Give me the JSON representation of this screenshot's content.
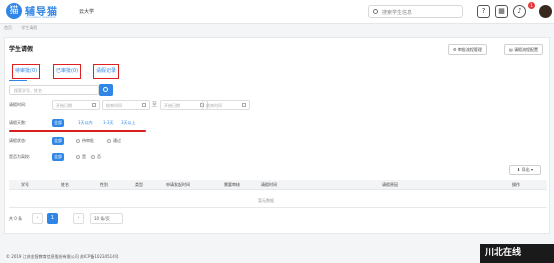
{
  "header": {
    "brand_title": "辅导猫",
    "brand_subtitle": "Counselor Assistant",
    "school": "云大学",
    "search_placeholder": "搜索学生信息",
    "help_glyph": "?",
    "notification_count": "1"
  },
  "breadcrumb": [
    "首页",
    "学生请假"
  ],
  "page": {
    "title": "学生请假",
    "buttons": [
      "审批流程管理",
      "请假流程配置"
    ]
  },
  "tabs": [
    {
      "label": "待审批(0)"
    },
    {
      "label": "已审批(0)"
    },
    {
      "label": "请假记录"
    }
  ],
  "filters": {
    "keyword_placeholder": "搜索学号、姓名",
    "time_label": "请假时间:",
    "start_date": "开始日期",
    "end_time": "结束时间",
    "start_date2": "开始日期",
    "end_time2": "结束时间",
    "date_sep": "至",
    "days_label": "请假天数:",
    "days_options": [
      "全部",
      "1天以内",
      "1-3天",
      "3天以上"
    ],
    "status_label": "请假状态:",
    "status_options": [
      "全部",
      "待审批",
      "通过"
    ],
    "school_label": "是否为离校:",
    "school_options": [
      "全部",
      "是",
      "否"
    ]
  },
  "table": {
    "export_label": "导出",
    "columns": [
      "学号",
      "姓名",
      "性别",
      "类型",
      "申请发起时间",
      "需要审核",
      "请假时间",
      "请假原因",
      "操作"
    ],
    "empty_text": "暂无数据"
  },
  "pagination": {
    "total": "共 0 条",
    "current": "1",
    "page_size": "10 条/页"
  },
  "footer": "© 2019 江苏金智教育信息股份有限公司 苏ICP备10234514号",
  "watermark": "川北在线",
  "colors": {
    "accent": "#2f86e6",
    "highlight": "#e02020"
  }
}
